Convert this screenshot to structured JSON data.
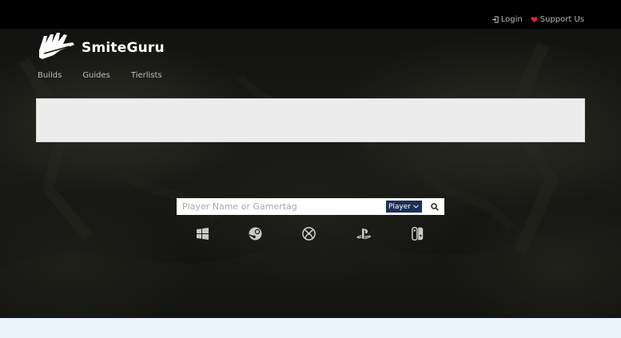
{
  "header": {
    "login_label": "Login",
    "support_label": "Support Us"
  },
  "brand": {
    "name": "SmiteGuru"
  },
  "nav": {
    "items": [
      {
        "label": "Builds"
      },
      {
        "label": "Guides"
      },
      {
        "label": "Tierlists"
      }
    ]
  },
  "search": {
    "placeholder": "Player Name or Gamertag",
    "value": "",
    "type_selected": "Player"
  },
  "platforms": [
    "windows-icon",
    "steam-icon",
    "xbox-icon",
    "playstation-icon",
    "switch-icon"
  ],
  "colors": {
    "accent": "#1c2f55",
    "heart": "#e0263c",
    "footer": "#e9f3fb",
    "ad_background": "#ececec"
  }
}
